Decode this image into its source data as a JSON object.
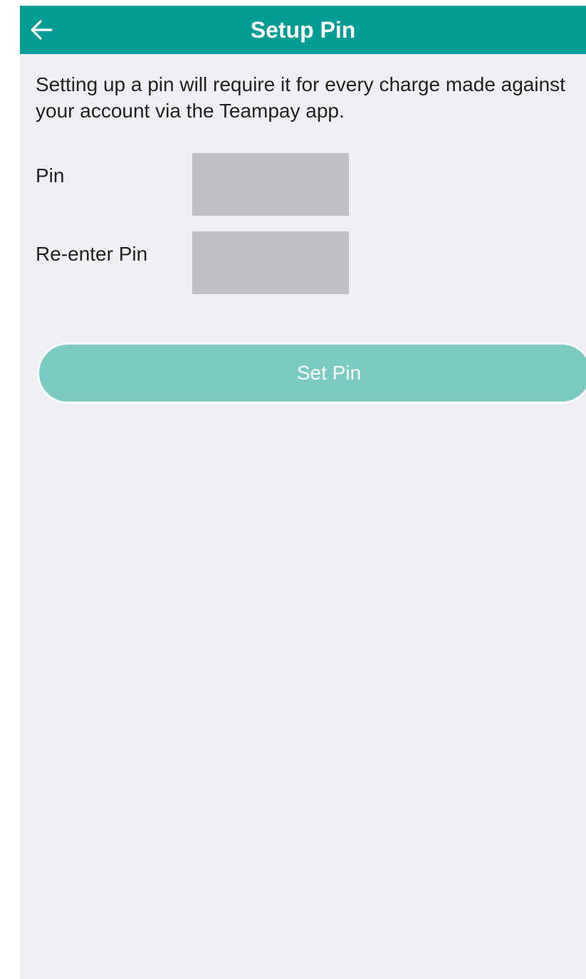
{
  "navbar": {
    "title": "Setup Pin",
    "back_icon": "arrow-left-icon",
    "background_color": "#019C94"
  },
  "description": "Setting up a pin will require it for every charge made against your account via the Teampay app.",
  "form": {
    "pin_label": "Pin",
    "pin_value": "",
    "reenter_label": "Re-enter Pin",
    "reenter_value": ""
  },
  "actions": {
    "set_pin_label": "Set Pin",
    "button_color": "#7BCBC3"
  },
  "colors": {
    "background": "#EFEEF3",
    "input_fill": "#C0BFC5"
  }
}
